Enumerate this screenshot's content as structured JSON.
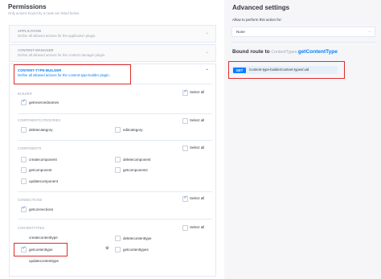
{
  "permissions": {
    "title": "Permissions",
    "subtitle": "Only actions bound by a route are listed below.",
    "plugins": [
      {
        "name": "APPLICATION",
        "description": "Define all allowed actions for the application plugin."
      },
      {
        "name": "CONTENT-MANAGER",
        "description": "Define all allowed actions for the content manager plugin."
      },
      {
        "name": "CONTENT-TYPE-BUILDER",
        "description": "Define all allowed actions for the content-type-builder plugin."
      }
    ],
    "select_all_label": "Select all",
    "sections": {
      "builder": {
        "label": "BUILDER",
        "actions": [
          "getreservednames"
        ]
      },
      "componentcategories": {
        "label": "COMPONENTCATEGORIES",
        "actions": [
          "deletecategory",
          "editcategory"
        ]
      },
      "components": {
        "label": "COMPONENTS",
        "actions": [
          "createcomponent",
          "deletecomponent",
          "getcomponent",
          "getcomponents",
          "updatecomponent"
        ]
      },
      "connections": {
        "label": "CONNECTIONS",
        "actions": [
          "getconnections"
        ]
      },
      "contenttypes": {
        "label": "CONTENTTYPES",
        "actions": [
          "createcontenttype",
          "deletecontenttype",
          "getcontenttype",
          "getcontenttypes",
          "updatecontenttype"
        ]
      }
    }
  },
  "advanced": {
    "title": "Advanced settings",
    "allow_label": "Allow to perform this action for:",
    "select_value": "None",
    "bound_route_prefix": "Bound route to",
    "bound_controller": "ContentTypes.",
    "bound_method": "getContentType",
    "route_method": "GET",
    "route_path": "/content-type-builder/content-types/:uid"
  },
  "colors": {
    "accent": "#007eff",
    "highlight": "#e02b2b"
  }
}
